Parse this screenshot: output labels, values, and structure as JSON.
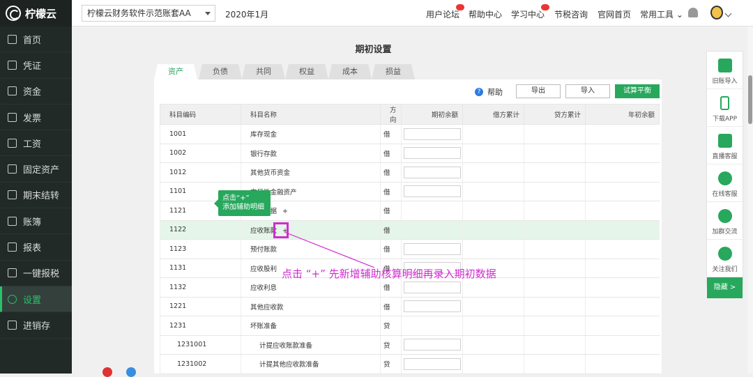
{
  "sidebar": {
    "logo": "柠檬云",
    "items": [
      {
        "label": "首页",
        "icon": "home-icon"
      },
      {
        "label": "凭证",
        "icon": "voucher-icon"
      },
      {
        "label": "资金",
        "icon": "fund-icon"
      },
      {
        "label": "发票",
        "icon": "invoice-icon"
      },
      {
        "label": "工资",
        "icon": "salary-icon"
      },
      {
        "label": "固定资产",
        "icon": "asset-icon"
      },
      {
        "label": "期末结转",
        "icon": "calendar-icon"
      },
      {
        "label": "账簿",
        "icon": "book-icon"
      },
      {
        "label": "报表",
        "icon": "chart-icon"
      },
      {
        "label": "一键报税",
        "icon": "tax-icon"
      },
      {
        "label": "设置",
        "icon": "gear-icon"
      },
      {
        "label": "进销存",
        "icon": "stock-icon"
      }
    ],
    "active": "设置"
  },
  "topbar": {
    "account": "柠檬云财务软件示范账套AA",
    "period": "2020年1月",
    "links": [
      "用户论坛",
      "帮助中心",
      "学习中心",
      "节税咨询",
      "官网首页",
      "常用工具"
    ]
  },
  "page": {
    "title": "期初设置",
    "tabs": [
      "资产",
      "负债",
      "共同",
      "权益",
      "成本",
      "损益"
    ],
    "active_tab": "资产",
    "help": "帮助",
    "buttons": {
      "export": "导出",
      "import": "导入",
      "trial": "试算平衡"
    }
  },
  "table": {
    "headers": [
      "科目编码",
      "科目名称",
      "方向",
      "期初余额",
      "借方累计",
      "贷方累计",
      "年初余额"
    ],
    "rows": [
      {
        "code": "1001",
        "name": "库存现金",
        "dir": "借",
        "input": true
      },
      {
        "code": "1002",
        "name": "银行存款",
        "dir": "借",
        "input": true
      },
      {
        "code": "1012",
        "name": "其他货币资金",
        "dir": "借",
        "input": true
      },
      {
        "code": "1101",
        "name": "交易性金融资产",
        "dir": "借",
        "input": true
      },
      {
        "code": "1121",
        "name": "应收票据",
        "dir": "借",
        "input": false,
        "plus": "+"
      },
      {
        "code": "1122",
        "name": "应收账款",
        "dir": "借",
        "input": false,
        "plus": "+",
        "hl": true
      },
      {
        "code": "1123",
        "name": "预付账款",
        "dir": "借",
        "input": true
      },
      {
        "code": "1131",
        "name": "应收股利",
        "dir": "借",
        "input": true
      },
      {
        "code": "1132",
        "name": "应收利息",
        "dir": "借",
        "input": true
      },
      {
        "code": "1221",
        "name": "其他应收款",
        "dir": "借",
        "input": true
      },
      {
        "code": "1231",
        "name": "坏账准备",
        "dir": "贷",
        "input": false
      },
      {
        "code": "1231001",
        "name": "计提应收账款准备",
        "dir": "贷",
        "input": true,
        "sub": true
      },
      {
        "code": "1231002",
        "name": "计提其他应收款准备",
        "dir": "贷",
        "input": true,
        "sub": true
      }
    ]
  },
  "tooltip": {
    "line1": "点击“+”",
    "line2": "添加辅助明细"
  },
  "annotation": "点击 “+” 先新增辅助核算明细再录入期初数据",
  "right_panel": {
    "items": [
      "旧账导入",
      "下载APP",
      "直播客服",
      "在线客服",
      "加群交流",
      "关注我们"
    ],
    "hide": "隐藏 >"
  },
  "colors": {
    "brand": "#27a85d",
    "highlight": "#d12bd1",
    "sidebar": "#222a28"
  }
}
